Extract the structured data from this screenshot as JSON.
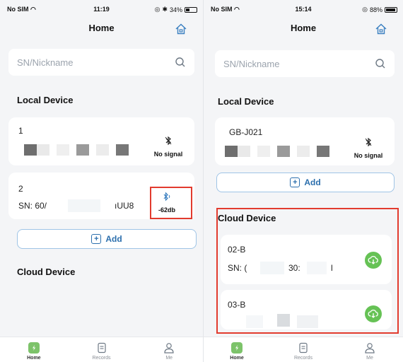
{
  "left": {
    "status": {
      "carrier": "No SIM",
      "time": "11:19",
      "battery": "34%",
      "battery_level": 0.34
    },
    "title": "Home",
    "search": {
      "placeholder": "SN/Nickname"
    },
    "local_section": "Local Device",
    "devices": [
      {
        "name": "1",
        "signal": "No signal"
      },
      {
        "name": "2",
        "sn_left": "SN: 60/",
        "sn_right": "ıUU8",
        "signal": "-62db"
      }
    ],
    "add_label": "Add",
    "cloud_section": "Cloud Device",
    "tabs": [
      {
        "label": "Home",
        "icon": "home-icon"
      },
      {
        "label": "Records",
        "icon": "records-icon"
      },
      {
        "label": "Me",
        "icon": "user-icon"
      }
    ]
  },
  "right": {
    "status": {
      "carrier": "No SIM",
      "time": "15:14",
      "battery": "88%",
      "battery_level": 0.88
    },
    "title": "Home",
    "search": {
      "placeholder": "SN/Nickname"
    },
    "local_section": "Local Device",
    "devices": [
      {
        "name": "GB-J021",
        "signal": "No signal"
      }
    ],
    "add_label": "Add",
    "cloud_section": "Cloud Device",
    "cloud_devices": [
      {
        "name": "02-B",
        "sn_left": "SN: (",
        "sn_mid": "30:",
        "sn_right": "l"
      },
      {
        "name": "03-B"
      }
    ],
    "tabs": [
      {
        "label": "Home",
        "icon": "home-icon"
      },
      {
        "label": "Records",
        "icon": "records-icon"
      },
      {
        "label": "Me",
        "icon": "user-icon"
      }
    ]
  },
  "colors": {
    "accent": "#2c6fad",
    "highlight": "#e23b2e",
    "cloud_green": "#66c255",
    "home_green": "#7dc36a"
  }
}
